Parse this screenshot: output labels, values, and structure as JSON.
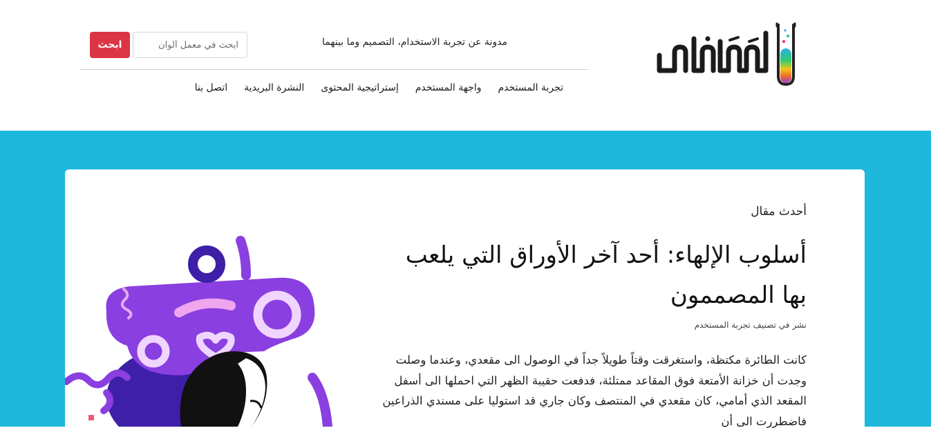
{
  "site": {
    "logo_text": "معمل ألوان",
    "tagline": "مدونة عن تجربة الاستخدام، التصميم وما بينهما"
  },
  "search": {
    "placeholder": "ابحث في معمل ألوان",
    "button_label": "ابحث"
  },
  "nav": {
    "items": [
      {
        "label": "تجربة المستخدم"
      },
      {
        "label": "واجهة المستخدم"
      },
      {
        "label": "إستراتيجية المحتوى"
      },
      {
        "label": "النشرة البريدية"
      },
      {
        "label": "اتصل بنا"
      }
    ]
  },
  "hero": {
    "latest_label": "أحدث مقال",
    "title": "أسلوب الإلهاء: أحد آخر الأوراق التي يلعب بها المصممون",
    "meta_prefix": "نشر في تصنيف",
    "meta_category": "تجربة المستخدم",
    "excerpt": "كانت الطائرة مكتظة، واستغرقت وقتاً طويلاً جداً في الوصول الى مقعدي، وعندما وصلت وجدت أن خزانة الأمتعة فوق المقاعد ممتلئة، فدفعت حقيبة الظهر التي احملها الى أسفل المقعد الذي أمامي، كان مقعدي في المنتصف وكان جاري قد استوليا على مسندي الذراعين فاضطررت الى أن"
  },
  "colors": {
    "accent": "#dc3545",
    "hero_background": "#1eb8dc",
    "illustration_purple": "#8a3fe0",
    "illustration_dark_purple": "#3d1fa8",
    "illustration_pink": "#f0a6ec"
  }
}
